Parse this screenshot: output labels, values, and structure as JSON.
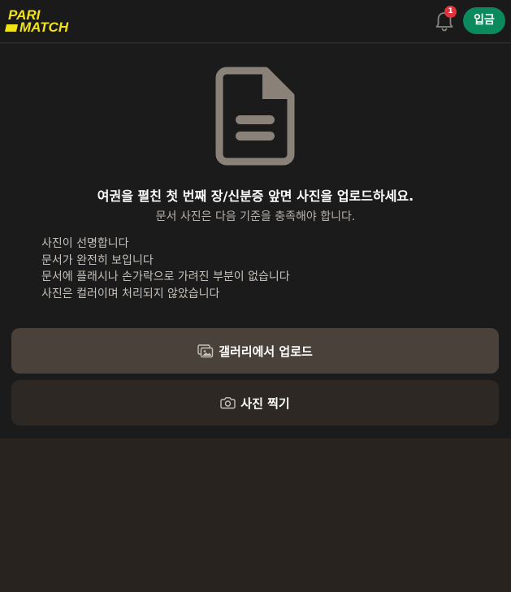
{
  "header": {
    "logo_line1": "PARI",
    "logo_line2": "MATCH",
    "notification_count": "1",
    "deposit_label": "입금"
  },
  "main": {
    "title": "여권을 펼친 첫 번째 장/신분증 앞면 사진을 업로드하세요.",
    "subtitle": "문서 사진은 다음 기준을 충족해야 합니다.",
    "criteria": [
      "사진이 선명합니다",
      "문서가 완전히 보입니다",
      "문서에 플래시나 손가락으로 가려진 부분이 없습니다",
      "사진은 컬러이며 처리되지 않았습니다"
    ],
    "upload_gallery_label": "갤러리에서 업로드",
    "take_photo_label": "사진 찍기"
  },
  "colors": {
    "brand_yellow": "#f2e316",
    "deposit_green": "#0b8a5e",
    "badge_red": "#e0343c",
    "doc_icon": "#8a8178"
  },
  "icons": [
    "parimatch-logo",
    "bell-icon",
    "document-icon",
    "gallery-icon",
    "camera-icon"
  ]
}
